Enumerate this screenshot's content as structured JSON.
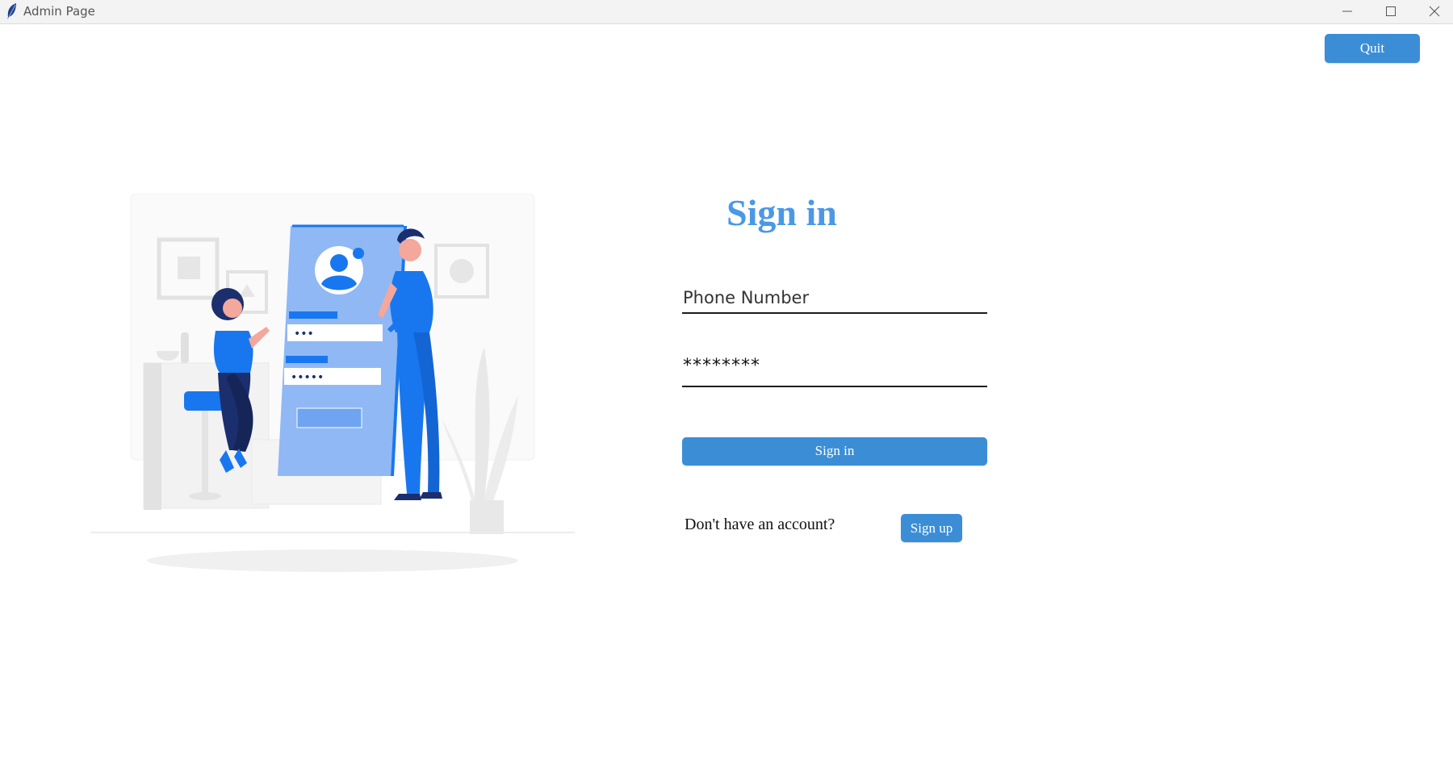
{
  "window": {
    "title": "Admin Page",
    "app_icon": "feather-icon",
    "controls": [
      "minimize-icon",
      "maximize-icon",
      "close-icon"
    ]
  },
  "header": {
    "quit_label": "Quit"
  },
  "illustration": {
    "subject": "login-illustration",
    "masked_left": "•••",
    "masked_right": "•••••"
  },
  "form": {
    "title": "Sign in",
    "phone_placeholder": "Phone Number",
    "password_value": "********",
    "submit_label": "Sign in",
    "account_prompt": "Don't have an account?",
    "signup_label": "Sign up"
  },
  "colors": {
    "accent": "#3b8ed6",
    "title": "#4a98e6",
    "illustration_blue": "#1877ee",
    "illustration_navy": "#1b2e6e"
  }
}
